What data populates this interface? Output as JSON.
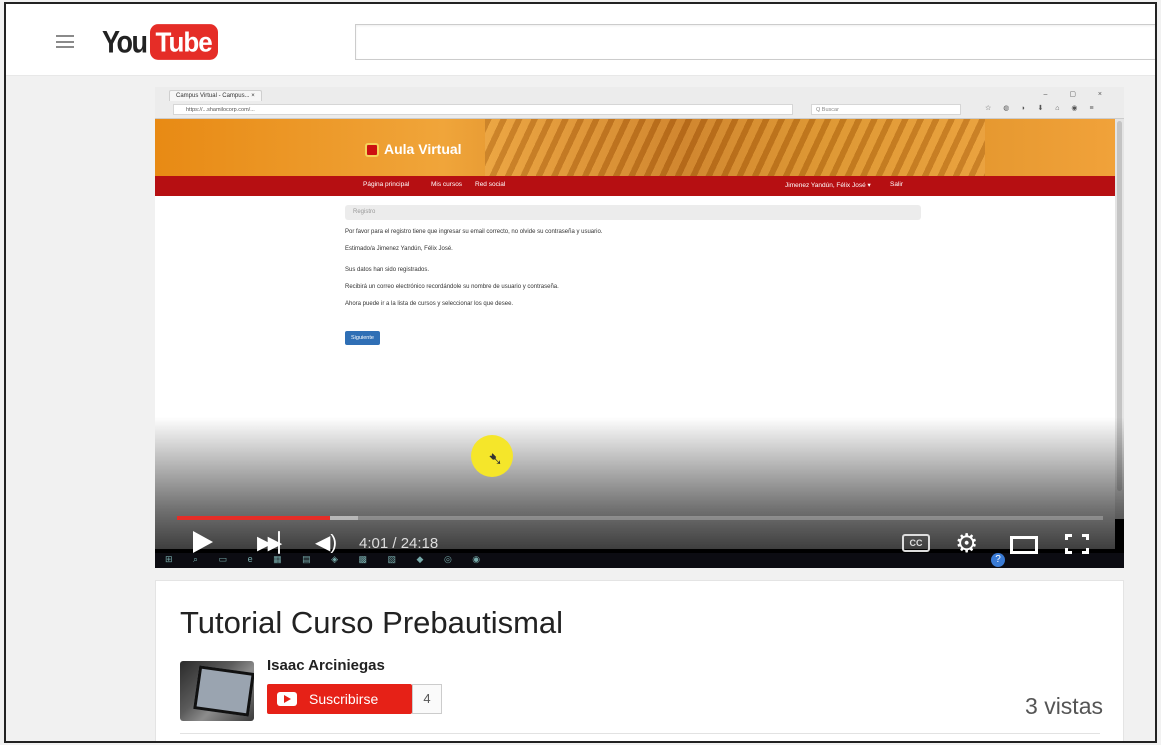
{
  "masthead": {
    "logo_you": "You",
    "logo_tube": "Tube",
    "search_placeholder": ""
  },
  "embedded_browser": {
    "tab_title": "Campus Virtual - Campus... ×",
    "url": "https://...shamilocorp.com/...",
    "search_placeholder": "Q Buscar"
  },
  "embedded_site": {
    "logo_text": "Aula Virtual",
    "nav": {
      "home": "Página principal",
      "my_courses": "Mis cursos",
      "social": "Red social",
      "user": "Jimenez Yandún, Félix José ▾",
      "logout": "Salir"
    },
    "breadcrumb": "Registro",
    "lines": [
      "Por favor para el registro tiene que ingresar su email correcto, no olvide su contraseña y usuario.",
      "Estimado/a Jimenez Yandún, Félix José.",
      "Sus datos han sido registrados.",
      "Recibirá un correo electrónico recordándole su nombre de usuario y contraseña.",
      "Ahora puede ir a la lista de cursos y seleccionar los que desee."
    ],
    "next_button": "Siguiente"
  },
  "player": {
    "current_time": "4:01",
    "duration": "24:18",
    "time_display": "4:01 / 24:18",
    "played_fraction": 0.165,
    "buffered_fraction": 0.195,
    "cc_label": "CC",
    "help_label": "?"
  },
  "video": {
    "title": "Tutorial Curso Prebautismal",
    "channel": "Isaac Arciniegas",
    "subscribe_label": "Suscribirse",
    "subscriber_count": "4",
    "views": "3 vistas"
  },
  "colors": {
    "youtube_red": "#e52d27",
    "banner_orange": "#e88a14",
    "nav_red": "#b60f12"
  }
}
